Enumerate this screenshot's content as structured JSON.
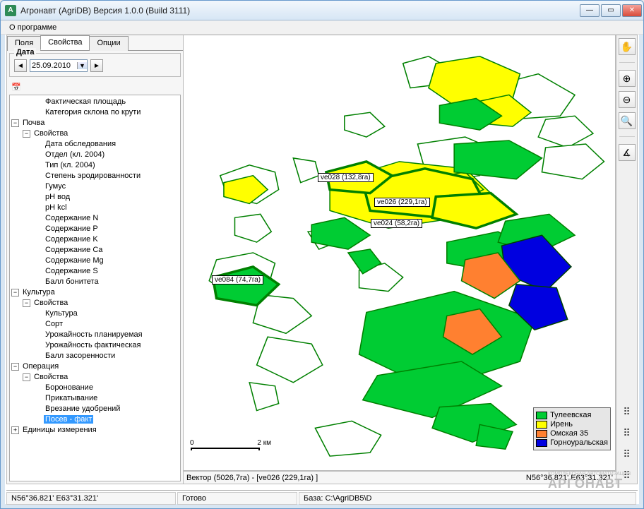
{
  "window": {
    "title": "Агронавт (AgriDB) Версия 1.0.0 (Build 3111)",
    "app_letter": "А"
  },
  "menubar": {
    "about": "О программе"
  },
  "sidebar_tabs": {
    "fields": "Поля",
    "properties": "Свойства",
    "options": "Опции"
  },
  "date_picker": {
    "label": "Дата",
    "value": "25.09.2010"
  },
  "tree": {
    "n_fact_area": "Фактическая площадь",
    "n_slope_cat": "Категория склона по крути",
    "soil": "Почва",
    "soil_props": "Свойства",
    "soil_items": {
      "survey_date": "Дата обследования",
      "dept_2004": "Отдел (кл. 2004)",
      "type_2004": "Тип (кл. 2004)",
      "erosion": "Степень эродированности",
      "humus": "Гумус",
      "ph_water": "pH вод",
      "ph_kcl": "pH kcl",
      "n": "Содержание N",
      "p": "Содержание P",
      "k": "Содержание K",
      "ca": "Содержание Ca",
      "mg": "Содержание Mg",
      "s": "Содержание S",
      "bonitet": "Балл бонитета"
    },
    "culture": "Культура",
    "culture_props": "Свойства",
    "culture_items": {
      "culture": "Культура",
      "sort": "Сорт",
      "yield_plan": "Урожайность планируемая",
      "yield_fact": "Урожайность фактическая",
      "weed": "Балл засоренности"
    },
    "operation": "Операция",
    "operation_props": "Свойства",
    "operation_items": {
      "harrowing": "Боронование",
      "rolling": "Прикатывание",
      "fertilizer": "Врезание удобрений",
      "seeding_fact": "Посев - факт"
    },
    "units": "Единицы измерения"
  },
  "map": {
    "labels": {
      "ve028": "ve028 (132,8га)",
      "ve026": "ve026 (229,1га)",
      "ve024": "ve024 (58,2га)",
      "ve084": "ve084 (74,7га)"
    },
    "scale": {
      "zero": "0",
      "end": "2 км"
    },
    "legend": {
      "tuleevskaya": "Тулеевская",
      "iren": "Ирень",
      "omskaya35": "Омская 35",
      "gornouralskaya": "Горноуральская"
    },
    "colors": {
      "tuleevskaya": "#00cc33",
      "iren": "#ffff00",
      "omskaya35": "#ff8030",
      "gornouralskaya": "#0000e0"
    },
    "status_left": "Вектор (5026,7га) - [ve026 (229,1га) ]",
    "status_right": "N56°36.821' E63°31.321'"
  },
  "bottom_status": {
    "coords": "N56°36.821'  E63°31.321'",
    "ready": "Готово",
    "db": "База: C:\\AgriDB5\\D"
  },
  "watermark": {
    "brand": "РГОНАВТ",
    "sub": "КОМПЛЕКСНАЯ АВТОМАТИЗАЦИЯ"
  }
}
